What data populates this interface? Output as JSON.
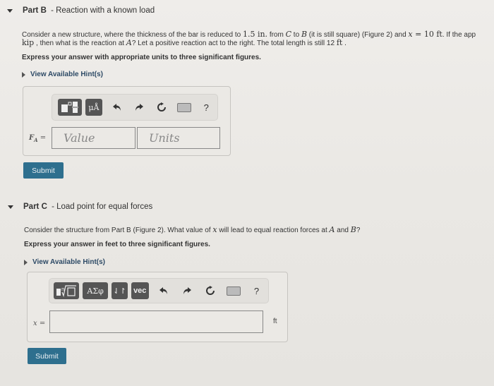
{
  "partB": {
    "label": "Part B",
    "sep": " - ",
    "title": "Reaction with a known load",
    "line1": {
      "t1": "Consider a new structure, where the thickness of the bar is reduced to ",
      "v1": "1.5 in.",
      "t2": " from ",
      "C": "C",
      "t3": " to ",
      "B": "B",
      "t4": " (it is still square) (",
      "figure": "Figure 2",
      "t5": ") and ",
      "x": "x",
      "eq": " = 10 ft",
      "t6": ". If the app"
    },
    "line2": {
      "kip": "kip",
      "t1": " , then what is the reaction at ",
      "A": "A",
      "t2": "? Let a positive reaction act to the right. The total length is still 12 ",
      "ft": "ft",
      "t3": " ."
    },
    "instruction": "Express your answer with appropriate units to three significant figures.",
    "hints": "View Available Hint(s)",
    "toolbar": {
      "templates_label": "templates",
      "units_label": "μÅ",
      "help": "?"
    },
    "answer_label": "F",
    "answer_sub": "A",
    "answer_eq": " =",
    "value_placeholder": "Value",
    "units_placeholder": "Units",
    "submit": "Submit"
  },
  "partC": {
    "label": "Part C",
    "sep": " - ",
    "title": "Load point for equal forces",
    "line1": {
      "t1": "Consider the structure from Part B (",
      "figure": "Figure 2",
      "t2": "). What value of ",
      "x": "x",
      "t3": " will lead to equal reaction forces at ",
      "A": "A",
      "t4": " and ",
      "B": "B",
      "t5": "?"
    },
    "instruction": "Express your answer in feet to three significant figures.",
    "hints": "View Available Hint(s)",
    "toolbar": {
      "greek": "ΑΣφ",
      "arrows": "⇃↾",
      "vec": "vec",
      "help": "?"
    },
    "answer_label": "x",
    "answer_eq": " =",
    "answer_value": "",
    "unit": "ft",
    "submit": "Submit"
  }
}
